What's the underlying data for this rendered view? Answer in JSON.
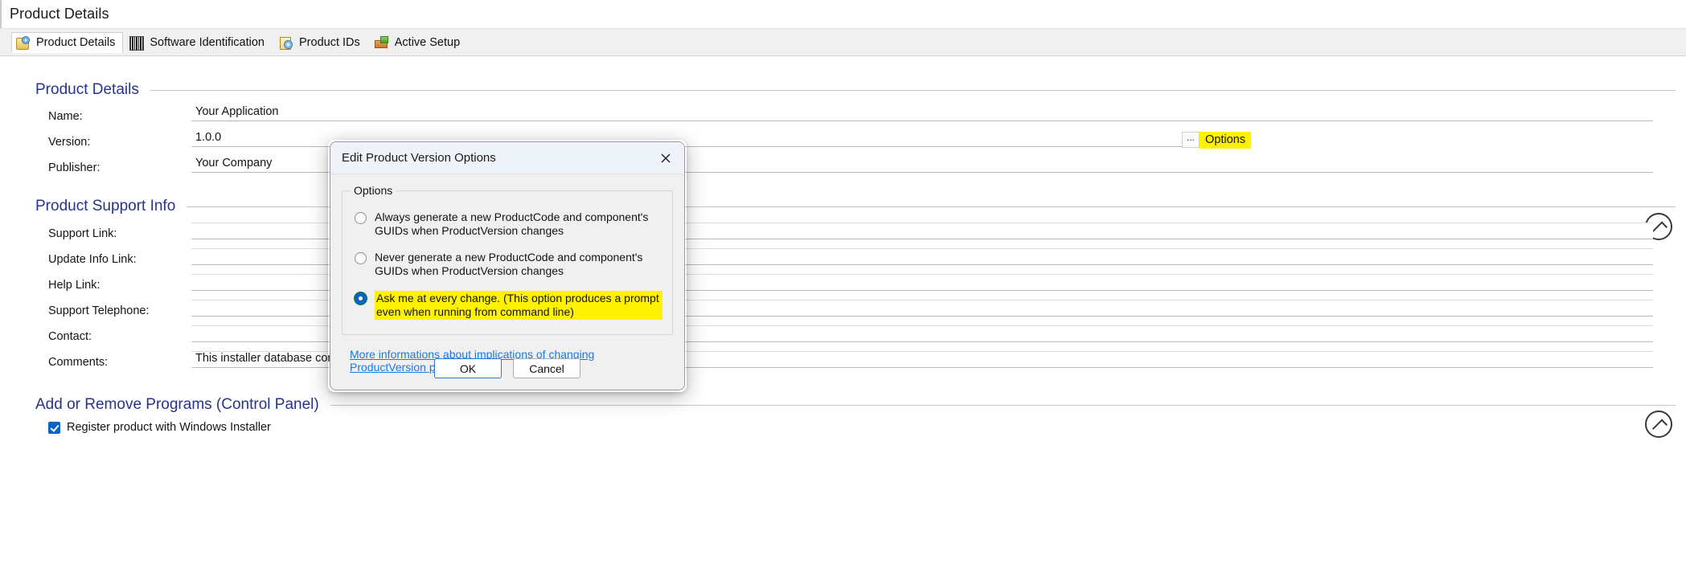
{
  "window": {
    "title": "Product Details"
  },
  "tabs": [
    {
      "label": "Product Details",
      "icon": "product-details-icon",
      "active": true
    },
    {
      "label": "Software Identification",
      "icon": "barcode-icon",
      "active": false
    },
    {
      "label": "Product IDs",
      "icon": "product-ids-icon",
      "active": false
    },
    {
      "label": "Active Setup",
      "icon": "active-setup-icon",
      "active": false
    }
  ],
  "sections": {
    "product_details": {
      "header": "Product Details",
      "fields": [
        {
          "label": "Name:",
          "value": "Your Application"
        },
        {
          "label": "Version:",
          "value": "1.0.0"
        },
        {
          "label": "Publisher:",
          "value": "Your Company"
        }
      ],
      "ellipsis_label": "...",
      "options_button": "Options"
    },
    "product_support_info": {
      "header": "Product Support Info",
      "fields": [
        {
          "label": "Support Link:",
          "value": ""
        },
        {
          "label": "Update Info Link:",
          "value": ""
        },
        {
          "label": "Help Link:",
          "value": ""
        },
        {
          "label": "Support Telephone:",
          "value": ""
        },
        {
          "label": "Contact:",
          "value": ""
        },
        {
          "label": "Comments:",
          "value": "This installer database contains"
        }
      ]
    },
    "add_remove_programs": {
      "header": "Add or Remove Programs (Control Panel)",
      "checkbox_label": "Register product with Windows Installer",
      "checkbox_checked": true
    }
  },
  "dialog": {
    "title": "Edit Product Version Options",
    "close_icon": "close-icon",
    "group_legend": "Options",
    "radios": [
      {
        "label": "Always generate a new ProductCode and component's GUIDs when ProductVersion changes",
        "checked": false,
        "highlighted": false
      },
      {
        "label": "Never generate a new ProductCode and component's GUIDs when ProductVersion changes",
        "checked": false,
        "highlighted": false
      },
      {
        "label": "Ask me at every change. (This option produces a prompt even when running from command line)",
        "checked": true,
        "highlighted": true
      }
    ],
    "link": "More informations about implications of changing ProductVersion property",
    "ok_label": "OK",
    "cancel_label": "Cancel"
  },
  "colors": {
    "section_header": "#26348b",
    "highlight": "#fff200",
    "accent_blue": "#0a63c6",
    "link": "#1a7ae0"
  }
}
